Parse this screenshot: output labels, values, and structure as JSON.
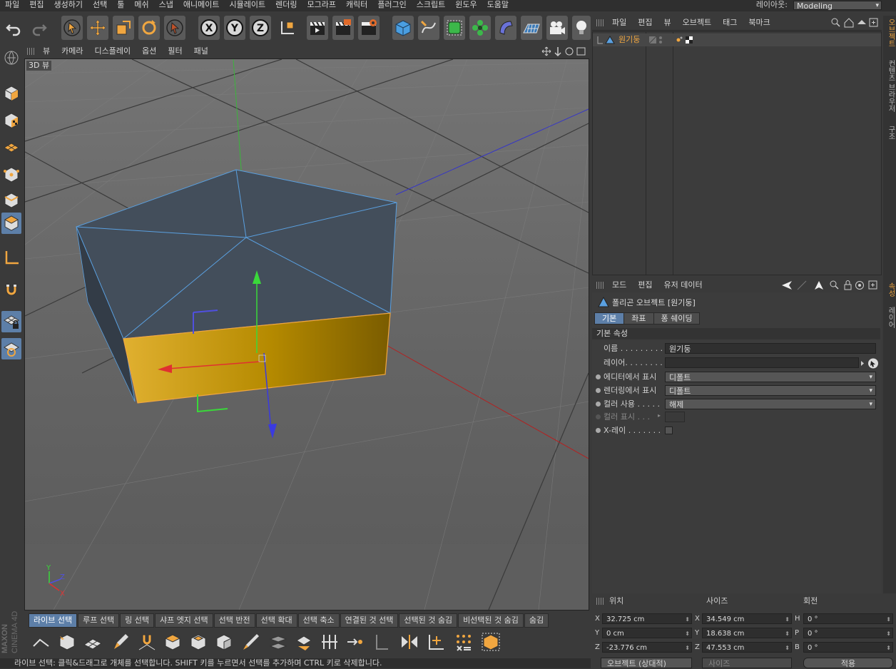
{
  "menubar": {
    "items": [
      "파일",
      "편집",
      "생성하기",
      "선택",
      "툴",
      "메쉬",
      "스냅",
      "애니메이트",
      "시뮬레이트",
      "렌더링",
      "모그라프",
      "캐릭터",
      "플러그인",
      "스크립트",
      "윈도우",
      "도움말"
    ],
    "layout_label": "레이아웃:",
    "layout_value": "Modeling"
  },
  "viewport": {
    "menu": [
      "뷰",
      "카메라",
      "디스플레이",
      "옵션",
      "필터",
      "패널"
    ],
    "label": "3D 뷰",
    "axis_x": "X",
    "axis_y": "Y",
    "axis_z": "Z"
  },
  "selection_tabs": [
    "라이브 선택",
    "루프 선택",
    "링 선택",
    "샤프 엣지 선택",
    "선택 반전",
    "선택 확대",
    "선택 축소",
    "연결된 것 선택",
    "선택된 것 숨김",
    "비선택된 것 숨김",
    "숨김"
  ],
  "status_text": "라이브 선택: 클릭&드래그로 개체를 선택합니다. SHIFT 키를 누르면서 선택를 추가하며 CTRL 키로 삭제합니다.",
  "brand": {
    "line1": "MAXON",
    "line2": "CINEMA 4D"
  },
  "object_manager": {
    "menu": [
      "파일",
      "편집",
      "뷰",
      "오브젝트",
      "태그",
      "북마크"
    ],
    "object_name": "원기둥"
  },
  "right_tabs_top": [
    "오브젝트",
    "컨텐츠 브라우저",
    "구조"
  ],
  "right_tabs_bottom": [
    "속성",
    "레이어"
  ],
  "attributes": {
    "menu": [
      "모드",
      "편집",
      "유저 데이터"
    ],
    "title": "폴리곤 오브젝트 [원기둥]",
    "tabs": [
      "기본",
      "좌표",
      "퐁 쉐이딩"
    ],
    "section": "기본 속성",
    "name_label": "이름 . . . . . . . . .",
    "name_value": "원기둥",
    "layer_label": "레이어. . . . . . . .",
    "editor_label": "에디터에서 표시",
    "editor_value": "디폴트",
    "render_label": "렌더링에서 표시",
    "render_value": "디폴트",
    "color_use_label": "컬러 사용 . . . . .",
    "color_use_value": "해제",
    "color_show_label": "컬러 표시 . . .",
    "xray_label": "X-레이 . . . . . . ."
  },
  "coords": {
    "headers": [
      "위치",
      "사이즈",
      "회전"
    ],
    "pos": {
      "x": "32.725 cm",
      "y": "0 cm",
      "z": "-23.776 cm"
    },
    "size": {
      "x": "34.549 cm",
      "y": "18.638 cm",
      "z": "47.553 cm"
    },
    "rot": {
      "h": "0 °",
      "p": "0 °",
      "b": "0 °"
    },
    "labels_pos": [
      "X",
      "Y",
      "Z"
    ],
    "labels_size": [
      "X",
      "Y",
      "Z"
    ],
    "labels_rot": [
      "H",
      "P",
      "B"
    ],
    "mode": "오브젝트 (상대적)",
    "size_mode": "사이즈",
    "apply": "적용"
  },
  "colors": {
    "accent_blue": "#5d7fa8",
    "selection_orange": "#f0a640",
    "polygon_yellow": "#c8a000"
  }
}
